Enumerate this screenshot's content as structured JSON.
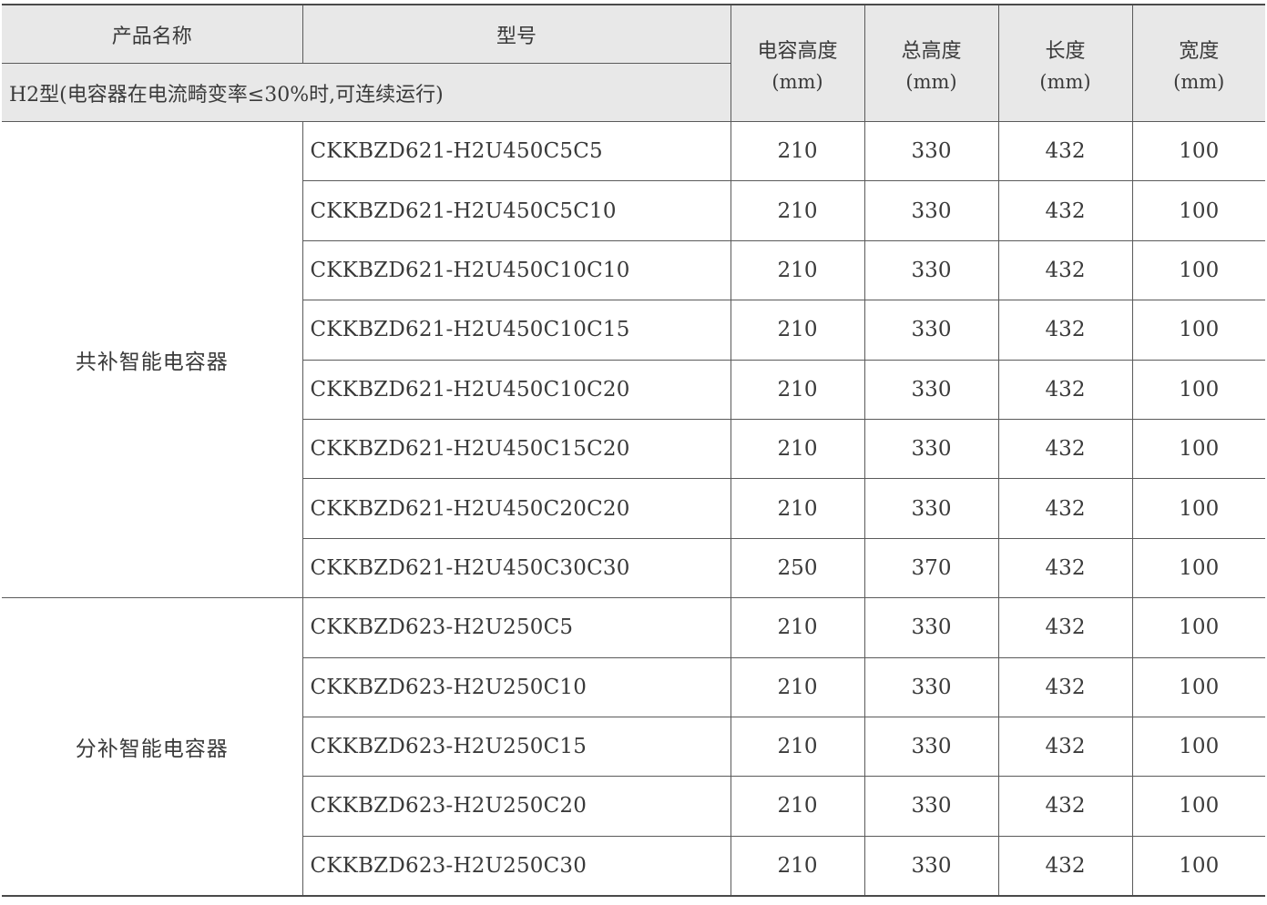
{
  "header": {
    "product_name": "产品名称",
    "model": "型号",
    "subtitle": "H2型(电容器在电流畸变率≤30%时,可连续运行)",
    "columns": [
      {
        "label": "电容高度",
        "unit": "(mm)"
      },
      {
        "label": "总高度",
        "unit": "(mm)"
      },
      {
        "label": "长度",
        "unit": "(mm)"
      },
      {
        "label": "宽度",
        "unit": "(mm)"
      }
    ]
  },
  "groups": [
    {
      "name": "共补智能电容器",
      "rows": [
        {
          "model": "CKKBZD621-H2U450C5C5",
          "cap_height": "210",
          "total_height": "330",
          "length": "432",
          "width": "100"
        },
        {
          "model": "CKKBZD621-H2U450C5C10",
          "cap_height": "210",
          "total_height": "330",
          "length": "432",
          "width": "100"
        },
        {
          "model": "CKKBZD621-H2U450C10C10",
          "cap_height": "210",
          "total_height": "330",
          "length": "432",
          "width": "100"
        },
        {
          "model": "CKKBZD621-H2U450C10C15",
          "cap_height": "210",
          "total_height": "330",
          "length": "432",
          "width": "100"
        },
        {
          "model": "CKKBZD621-H2U450C10C20",
          "cap_height": "210",
          "total_height": "330",
          "length": "432",
          "width": "100"
        },
        {
          "model": "CKKBZD621-H2U450C15C20",
          "cap_height": "210",
          "total_height": "330",
          "length": "432",
          "width": "100"
        },
        {
          "model": "CKKBZD621-H2U450C20C20",
          "cap_height": "210",
          "total_height": "330",
          "length": "432",
          "width": "100"
        },
        {
          "model": "CKKBZD621-H2U450C30C30",
          "cap_height": "250",
          "total_height": "370",
          "length": "432",
          "width": "100"
        }
      ]
    },
    {
      "name": "分补智能电容器",
      "rows": [
        {
          "model": "CKKBZD623-H2U250C5",
          "cap_height": "210",
          "total_height": "330",
          "length": "432",
          "width": "100"
        },
        {
          "model": "CKKBZD623-H2U250C10",
          "cap_height": "210",
          "total_height": "330",
          "length": "432",
          "width": "100"
        },
        {
          "model": "CKKBZD623-H2U250C15",
          "cap_height": "210",
          "total_height": "330",
          "length": "432",
          "width": "100"
        },
        {
          "model": "CKKBZD623-H2U250C20",
          "cap_height": "210",
          "total_height": "330",
          "length": "432",
          "width": "100"
        },
        {
          "model": "CKKBZD623-H2U250C30",
          "cap_height": "210",
          "total_height": "330",
          "length": "432",
          "width": "100"
        }
      ]
    }
  ]
}
